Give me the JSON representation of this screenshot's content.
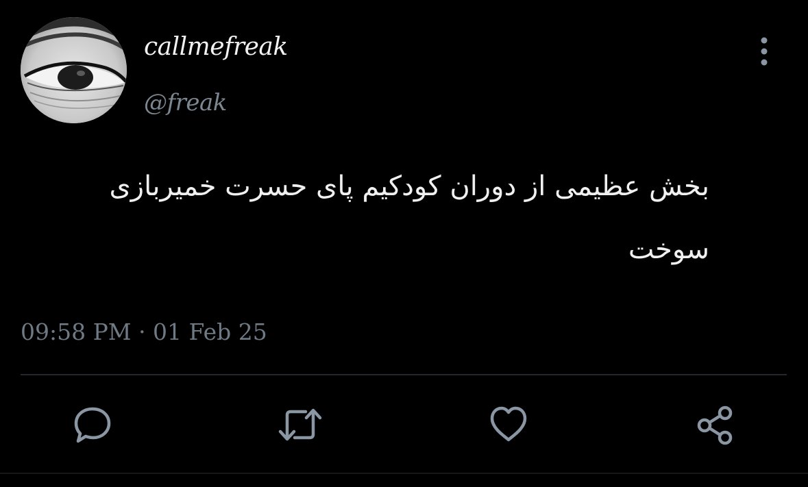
{
  "tweet": {
    "display_name": "callmefreak",
    "handle": "@freak",
    "text": "بخش عظیمی از دوران کودکیم پای حسرت خمیربازی سوخت",
    "timestamp": "09:58 PM · 01 Feb 25"
  },
  "icons": {
    "more": "more-vertical-icon",
    "reply": "reply-icon",
    "retweet": "retweet-icon",
    "like": "heart-icon",
    "share": "share-icon"
  },
  "colors": {
    "background": "#000000",
    "primary_text": "#f0f0f0",
    "secondary_text": "#7c8792",
    "icon": "#8a96a3",
    "divider": "#24282d"
  }
}
